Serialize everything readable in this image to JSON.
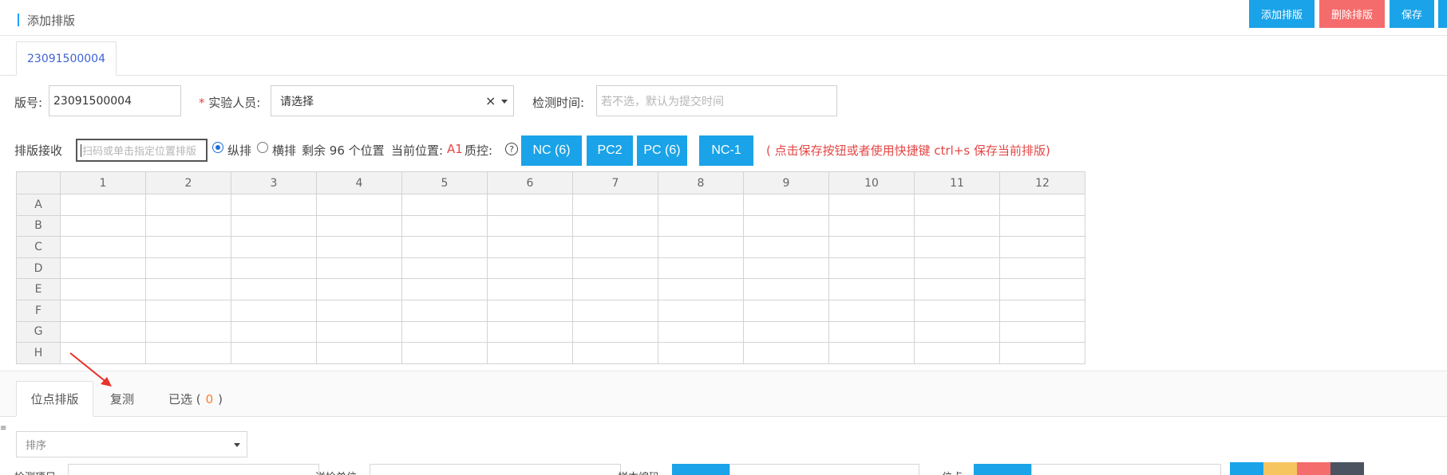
{
  "header": {
    "title": "添加排版",
    "buttons": [
      {
        "label": "添加排版",
        "color": "#1aa3e8"
      },
      {
        "label": "删除排版",
        "color": "#f56c6c"
      },
      {
        "label": "保存",
        "color": "#1aa3e8"
      }
    ]
  },
  "tabs": [
    {
      "label": "23091500004"
    }
  ],
  "form": {
    "plate_no_label": "版号:",
    "plate_no_value": "23091500004",
    "required_mark": "*",
    "tester_label": "实验人员:",
    "tester_value": "请选择",
    "clear_glyph": "×",
    "time_label": "检测时间:",
    "time_placeholder": "若不选，默认为提交时间"
  },
  "scan": {
    "label": "排版接收",
    "input_placeholder": "扫码或单击指定位置排版",
    "radio_vertical": "纵排",
    "radio_horizontal": "横排",
    "remaining_prefix": "剩余",
    "remaining_count": "96",
    "remaining_suffix": "个位置",
    "current_label": "当前位置:",
    "current_value": "A1",
    "qc_label": "质控:",
    "help_glyph": "?",
    "qc_buttons": [
      "NC (6)",
      "PC2",
      "PC (6)",
      "NC-1"
    ],
    "hint": "( 点击保存按钮或者使用快捷键 ctrl+s 保存当前排版)",
    "hint_color": "#e54545"
  },
  "grid": {
    "columns": [
      "1",
      "2",
      "3",
      "4",
      "5",
      "6",
      "7",
      "8",
      "9",
      "10",
      "11",
      "12"
    ],
    "rows": [
      "A",
      "B",
      "C",
      "D",
      "E",
      "F",
      "G",
      "H"
    ]
  },
  "bottom_tabs": {
    "site": "位点排版",
    "retest": "复测",
    "selected_prefix": "已选 (",
    "selected_count": "0",
    "selected_suffix": ")"
  },
  "filters": {
    "sort_placeholder": "排序",
    "row2_label1": "检测项目:",
    "row2_label2": "送检单位:",
    "row2_label3": "样本编码:",
    "row2_label4": "位点:"
  },
  "colors": {
    "accent": "#1aa3e8",
    "danger": "#f56c6c",
    "warning": "#f7c560",
    "dark": "#4b5360",
    "annotation": "#e8322b"
  }
}
